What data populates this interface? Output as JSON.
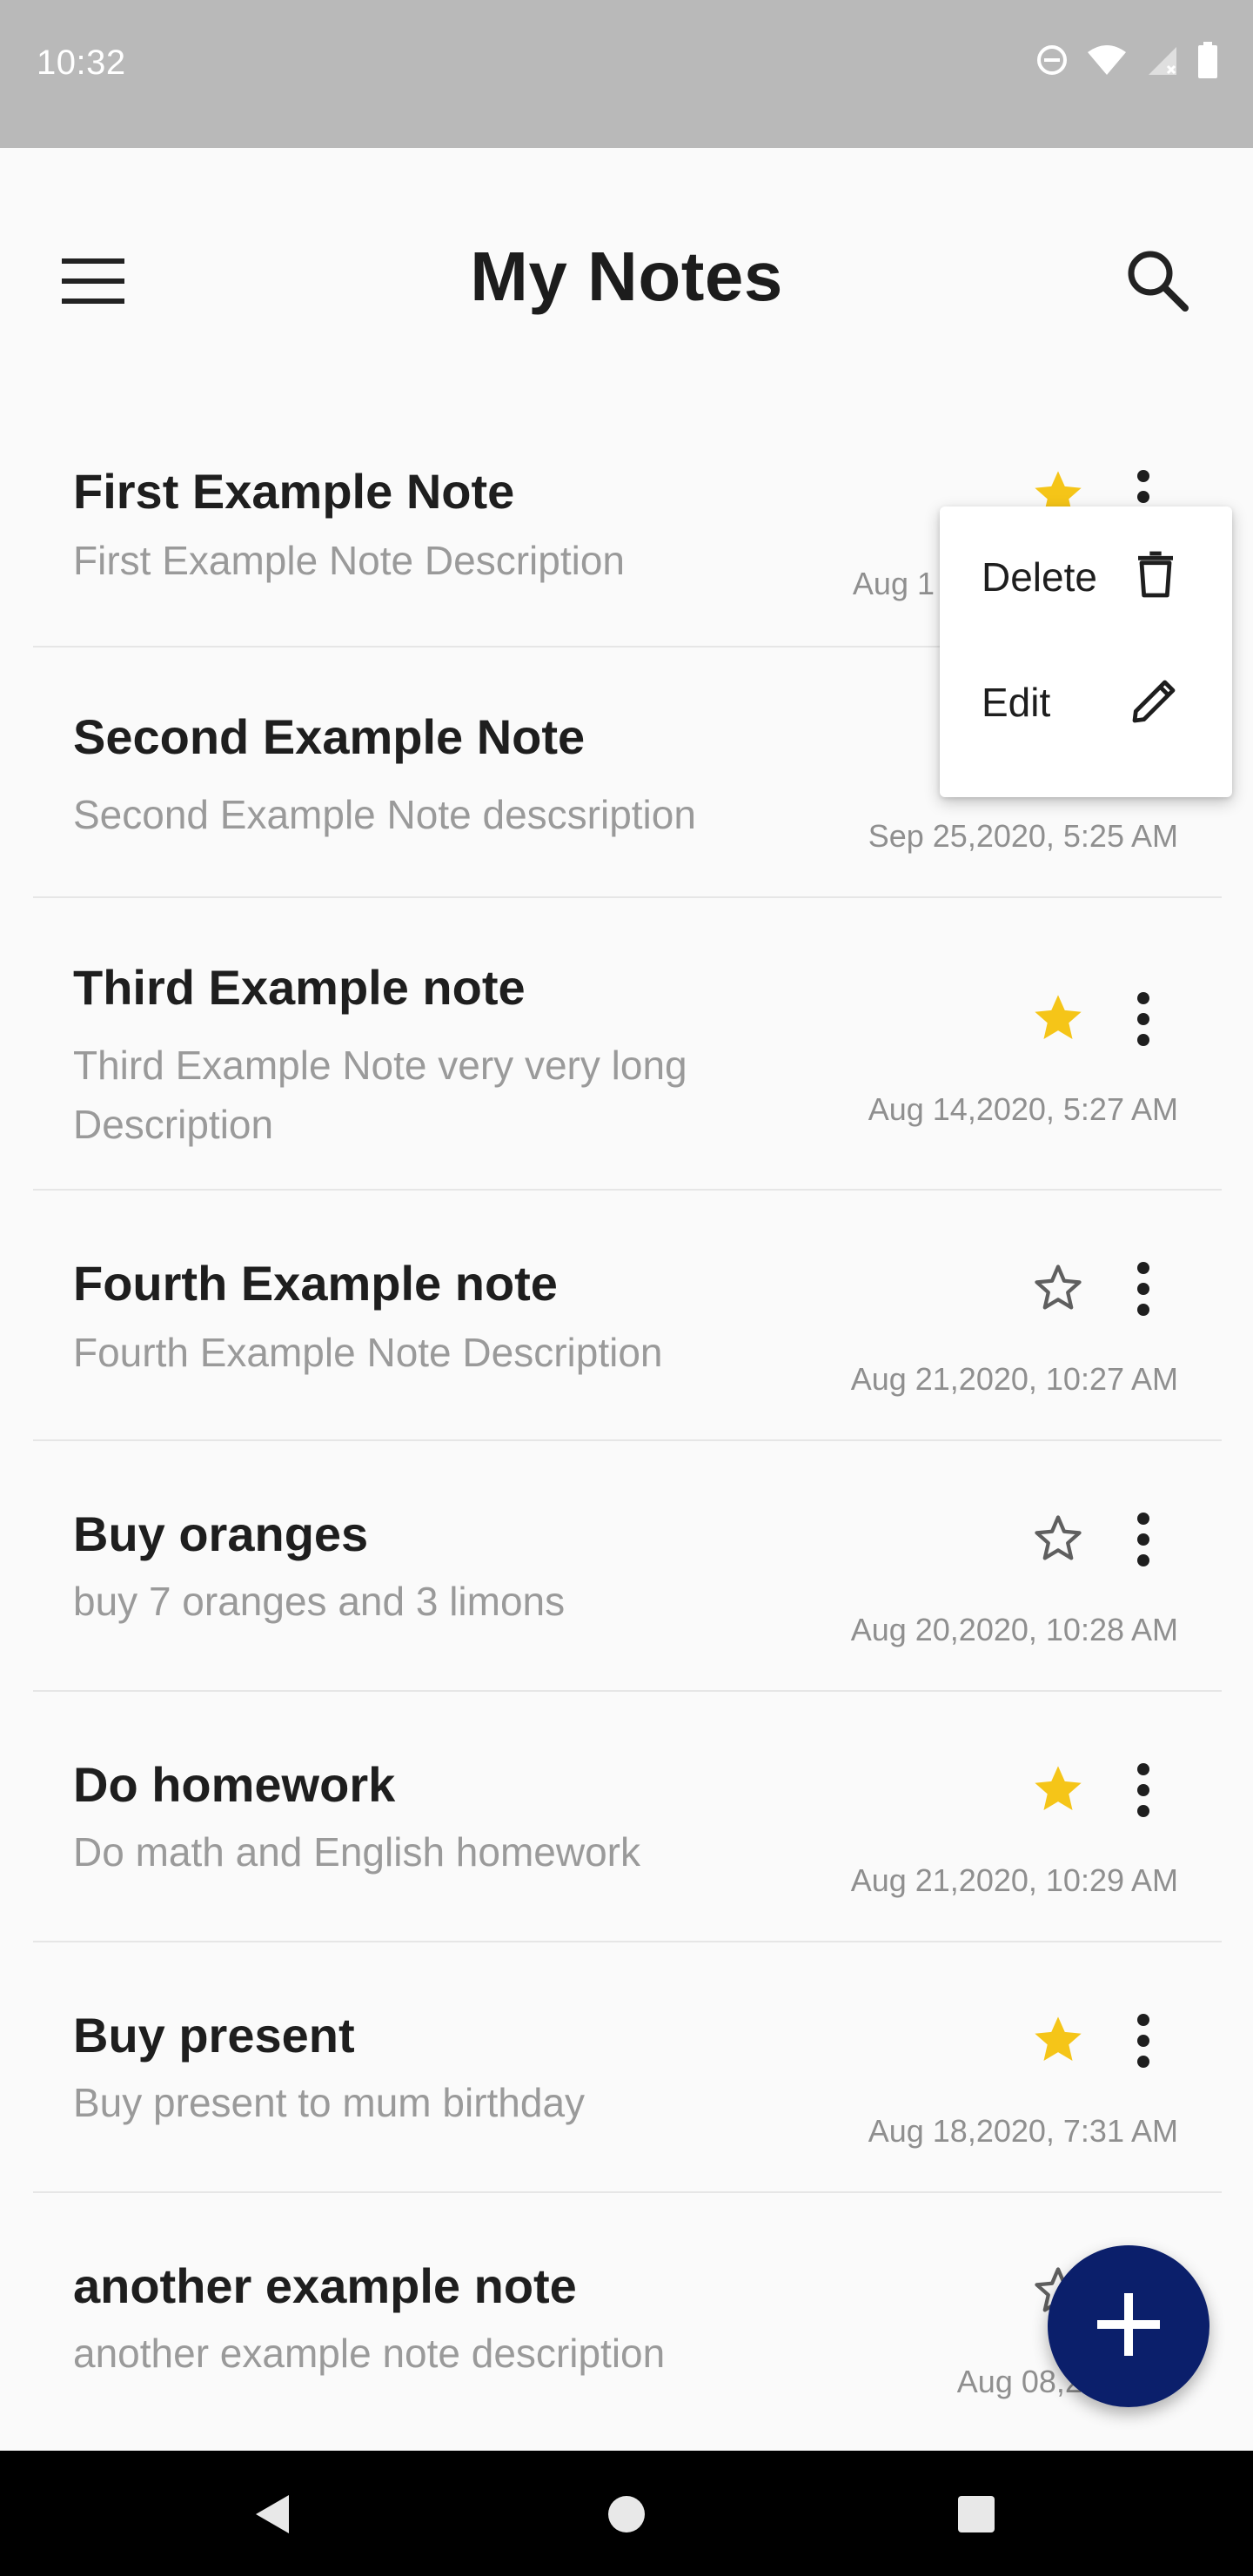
{
  "status_bar": {
    "time": "10:32",
    "icons": [
      "do-not-disturb-icon",
      "wifi-icon",
      "cell-signal-icon",
      "battery-icon"
    ]
  },
  "app_bar": {
    "title": "My Notes",
    "menu_icon": "hamburger-menu-icon",
    "search_icon": "search-icon"
  },
  "colors": {
    "star_active": "#f5c518",
    "star_inactive": "#5f5f5f",
    "fab": "#0b1f6b",
    "status_bar": "#b9b9b9"
  },
  "notes": [
    {
      "title": "First Example Note",
      "description": "First Example Note Description",
      "date": "Aug 1",
      "starred": true
    },
    {
      "title": "Second Example Note",
      "description": "Second Example Note descsription",
      "date": "Sep 25,2020, 5:25 AM",
      "starred": null
    },
    {
      "title": "Third Example note",
      "description": "Third Example Note very very long Description",
      "date": "Aug 14,2020, 5:27 AM",
      "starred": true
    },
    {
      "title": "Fourth Example note",
      "description": "Fourth Example Note Description",
      "date": "Aug 21,2020, 10:27 AM",
      "starred": false
    },
    {
      "title": "Buy oranges",
      "description": "buy 7 oranges and 3 limons",
      "date": "Aug 20,2020, 10:28 AM",
      "starred": false
    },
    {
      "title": "Do homework",
      "description": "Do math and English homework",
      "date": "Aug 21,2020, 10:29 AM",
      "starred": true
    },
    {
      "title": "Buy present",
      "description": "Buy present to mum birthday",
      "date": "Aug 18,2020, 7:31 AM",
      "starred": true
    },
    {
      "title": "another example note",
      "description": "another example note description",
      "date": "Aug 08,2020, 1",
      "starred": false
    }
  ],
  "context_menu": {
    "items": [
      {
        "label": "Delete",
        "icon": "trash-icon"
      },
      {
        "label": "Edit",
        "icon": "pencil-icon"
      }
    ]
  },
  "fab": {
    "icon": "plus-icon"
  },
  "nav_bar": {
    "icons": [
      "back-icon",
      "home-icon",
      "recents-icon"
    ]
  }
}
